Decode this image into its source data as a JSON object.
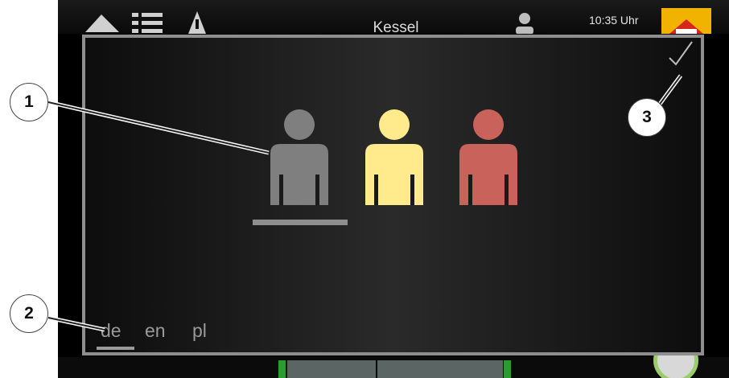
{
  "topbar": {
    "title": "Kessel",
    "clock": "10:35 Uhr",
    "icons": [
      "home-icon",
      "list-icon",
      "warning-icon",
      "user-icon",
      "logo-icon"
    ]
  },
  "dialog": {
    "users": [
      {
        "name": "user-grey",
        "color": "#7f7f7f",
        "selected": true
      },
      {
        "name": "user-yellow",
        "color": "#ffeb8c",
        "selected": false
      },
      {
        "name": "user-red",
        "color": "#c8625a",
        "selected": false
      }
    ],
    "confirm_icon": "checkmark-icon",
    "languages": [
      "de",
      "en",
      "pl"
    ],
    "selected_language": "de"
  },
  "callouts": [
    "1",
    "2",
    "3"
  ],
  "colors": {
    "dialog_border": "#8e8e8e",
    "logo": "#f2b300",
    "status_green": "#2f9a2f"
  }
}
